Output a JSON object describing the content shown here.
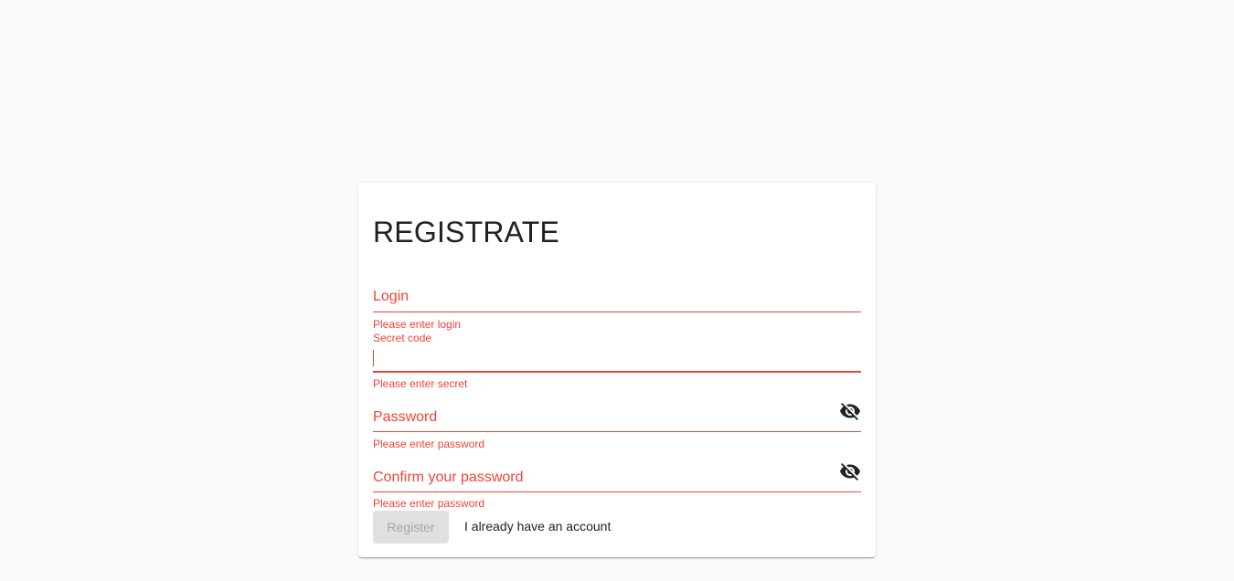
{
  "form": {
    "title": "REGISTRATE",
    "login": {
      "label": "Login",
      "value": "",
      "error": "Please enter login"
    },
    "secret": {
      "label": "Secret code",
      "value": "",
      "error": "Please enter secret"
    },
    "password": {
      "label": "Password",
      "value": "",
      "error": "Please enter password",
      "toggle_icon": "eye-off-icon"
    },
    "confirm": {
      "label": "Confirm your password",
      "value": "",
      "error": "Please enter password",
      "toggle_icon": "eye-off-icon"
    },
    "register_label": "Register",
    "account_link": "I already have an account"
  },
  "colors": {
    "error": "#f44336",
    "text": "#212121",
    "disabled_bg": "#e0e0e0",
    "disabled_text": "#a6a6a6",
    "background": "#fafafa"
  }
}
